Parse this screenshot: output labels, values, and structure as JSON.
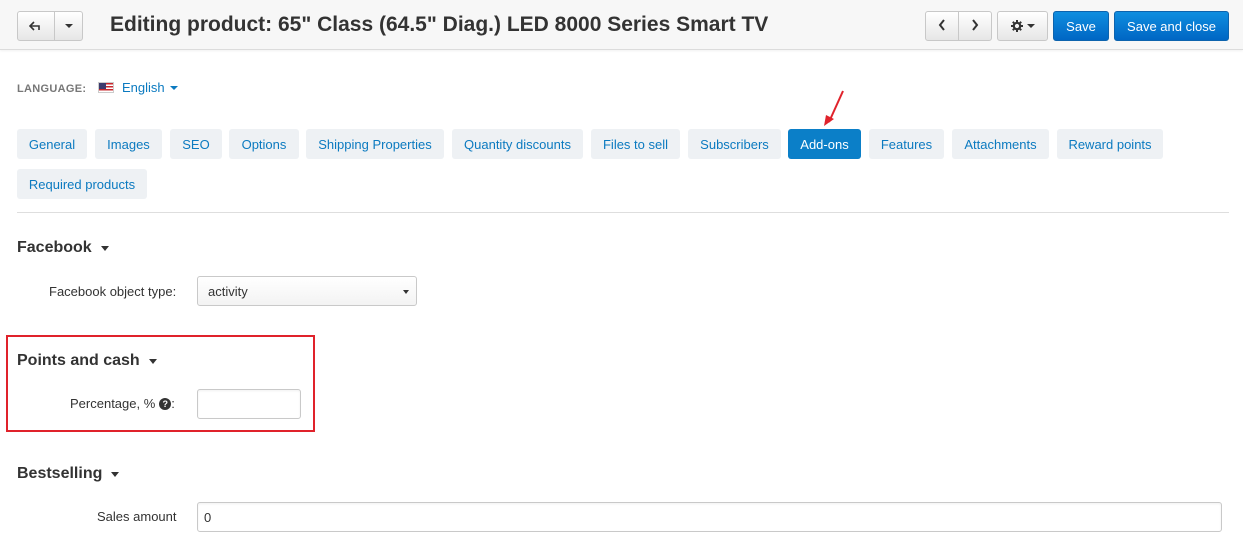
{
  "header": {
    "title": "Editing product: 65\" Class (64.5\" Diag.) LED 8000 Series Smart TV",
    "back_icon": "arrow-back-icon",
    "prev_icon": "chevron-left-icon",
    "next_icon": "chevron-right-icon",
    "gear_icon": "gear-icon",
    "save_label": "Save",
    "save_close_label": "Save and close"
  },
  "language": {
    "label": "LANGUAGE:",
    "selected": "English",
    "flag_icon": "us-flag-icon"
  },
  "tabs": [
    {
      "label": "General",
      "active": false
    },
    {
      "label": "Images",
      "active": false
    },
    {
      "label": "SEO",
      "active": false
    },
    {
      "label": "Options",
      "active": false
    },
    {
      "label": "Shipping Properties",
      "active": false
    },
    {
      "label": "Quantity discounts",
      "active": false
    },
    {
      "label": "Files to sell",
      "active": false
    },
    {
      "label": "Subscribers",
      "active": false
    },
    {
      "label": "Add-ons",
      "active": true
    },
    {
      "label": "Features",
      "active": false
    },
    {
      "label": "Attachments",
      "active": false
    },
    {
      "label": "Reward points",
      "active": false
    },
    {
      "label": "Required products",
      "active": false
    }
  ],
  "sections": {
    "facebook": {
      "title": "Facebook",
      "object_type_label": "Facebook object type:",
      "object_type_value": "activity"
    },
    "points_and_cash": {
      "title": "Points and cash",
      "percentage_label": "Percentage, %",
      "percentage_colon": ":",
      "percentage_value": ""
    },
    "bestselling": {
      "title": "Bestselling",
      "sales_amount_label": "Sales amount",
      "sales_amount_value": "0"
    }
  },
  "colors": {
    "accent": "#0b7fc8",
    "link": "#0b7ac0",
    "annotation": "#e0222b"
  }
}
